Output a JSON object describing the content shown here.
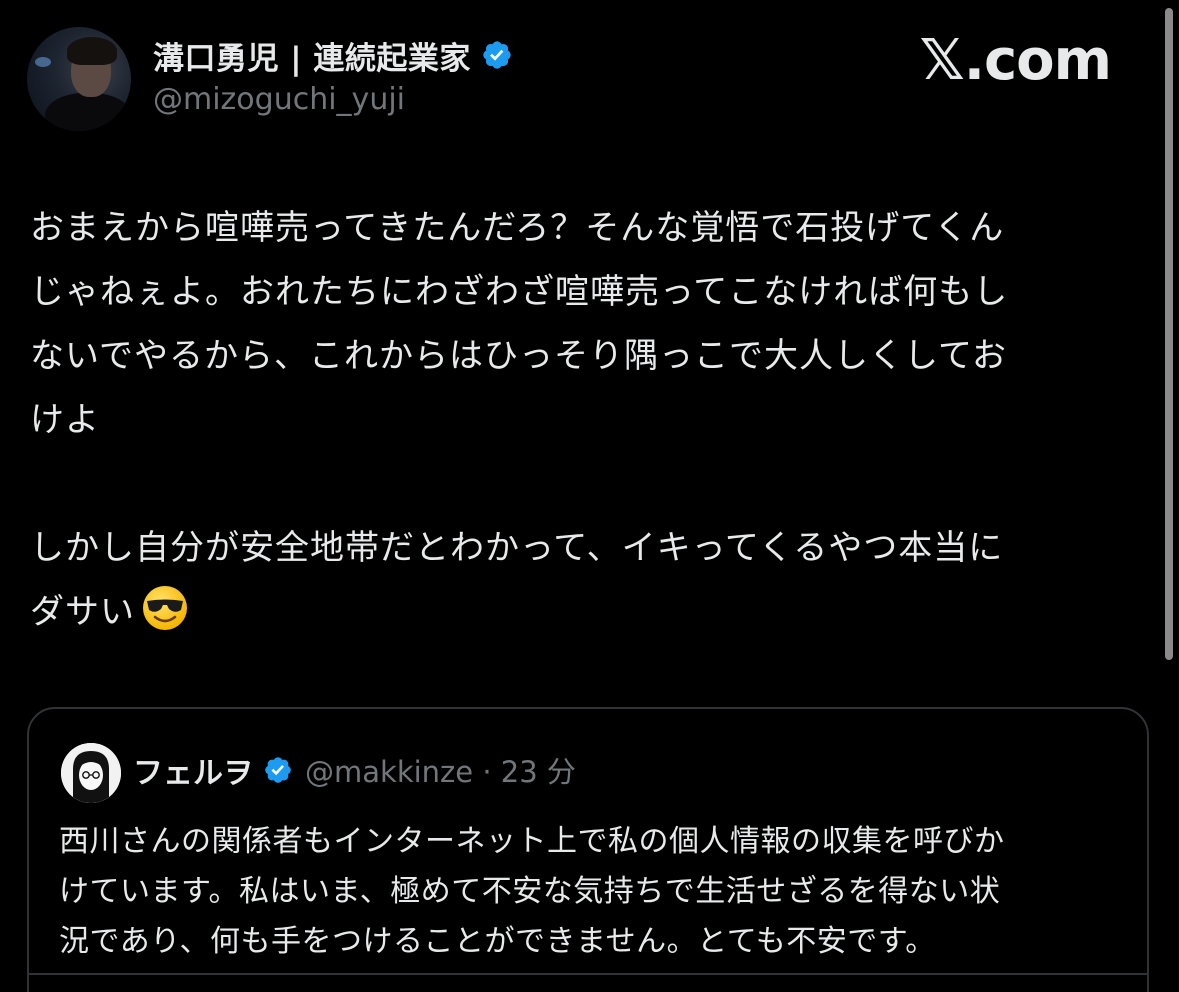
{
  "brand": {
    "logo_text": "𝕏.com"
  },
  "author": {
    "display_name": "溝口勇児 | 連続起業家",
    "handle": "@mizoguchi_yuji",
    "verified_icon": "verified-badge-icon"
  },
  "tweet": {
    "lines": [
      "おまえから喧嘩売ってきたんだろ？そんな覚悟で石投げてくん",
      "じゃねぇよ。おれたちにわざわざ喧嘩売ってこなければ何もし",
      "ないでやるから、これからはひっそり隅っこで大人しくしてお",
      "けよ"
    ],
    "lines2": [
      "しかし自分が安全地帯だとわかって、イキってくるやつ本当に",
      "ダサい"
    ],
    "emoji": "smiling-face-with-sunglasses-icon"
  },
  "quote": {
    "display_name": "フェルヲ",
    "handle_time": "@makkinze · 23 分",
    "verified_icon": "verified-badge-icon",
    "lines": [
      "西川さんの関係者もインターネット上で私の個人情報の収集を呼びか",
      "けています。私はいま、極めて不安な気持ちで生活せざるを得ない状",
      "況であり、何も手をつけることができません。とても不安です。"
    ]
  },
  "colors": {
    "background": "#000000",
    "text": "#e7e9ea",
    "secondary": "#71767b",
    "verified": "#1d9bf0",
    "border": "#2f3336"
  }
}
